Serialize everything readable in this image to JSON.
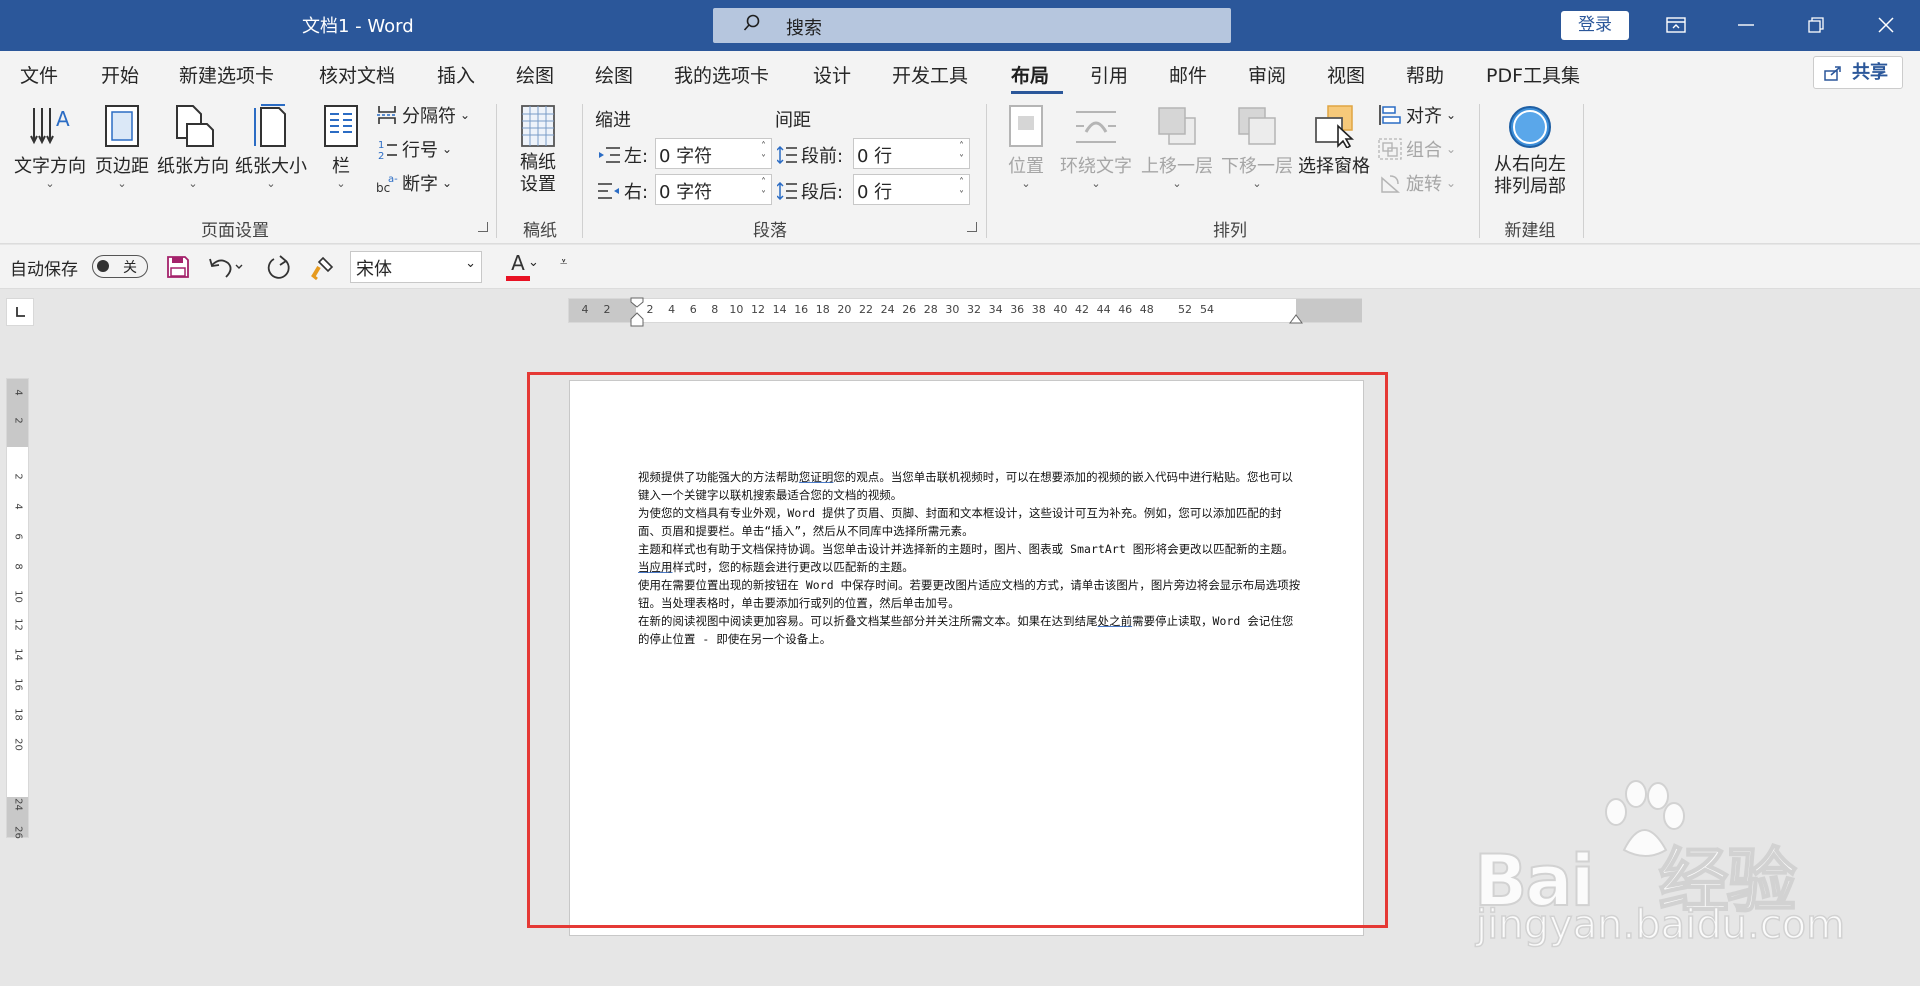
{
  "titlebar": {
    "title": "文档1  -  Word",
    "search_placeholder": "搜索",
    "login_label": "登录"
  },
  "menu": {
    "tabs": [
      {
        "label": "文件"
      },
      {
        "label": "开始"
      },
      {
        "label": "新建选项卡"
      },
      {
        "label": "核对文档"
      },
      {
        "label": "插入"
      },
      {
        "label": "绘图"
      },
      {
        "label": "绘图"
      },
      {
        "label": "我的选项卡"
      },
      {
        "label": "设计"
      },
      {
        "label": "开发工具"
      },
      {
        "label": "布局"
      },
      {
        "label": "引用"
      },
      {
        "label": "邮件"
      },
      {
        "label": "审阅"
      },
      {
        "label": "视图"
      },
      {
        "label": "帮助"
      },
      {
        "label": "PDF工具集"
      }
    ],
    "active_tab": "布局",
    "share_label": "共享"
  },
  "ribbon": {
    "page_setup": {
      "group_label": "页面设置",
      "text_direction": "文字方向",
      "margins": "页边距",
      "orientation": "纸张方向",
      "size": "纸张大小",
      "columns": "栏",
      "breaks": "分隔符",
      "line_numbers": "行号",
      "hyphenation": "断字"
    },
    "manuscript": {
      "group_label": "稿纸",
      "button": "稿纸\n设置",
      "button_line1": "稿纸",
      "button_line2": "设置"
    },
    "paragraph": {
      "group_label": "段落",
      "indent_title": "缩进",
      "spacing_title": "间距",
      "left_label": "左:",
      "right_label": "右:",
      "left_value": "0 字符",
      "right_value": "0 字符",
      "before_label": "段前:",
      "after_label": "段后:",
      "before_value": "0 行",
      "after_value": "0 行"
    },
    "arrange": {
      "group_label": "排列",
      "position": "位置",
      "wrap_text": "环绕文字",
      "bring_forward": "上移一层",
      "send_backward": "下移一层",
      "selection_pane": "选择窗格",
      "align": "对齐",
      "group": "组合",
      "rotate": "旋转"
    },
    "new_group": {
      "group_label": "新建组",
      "rtl_line1": "从右向左",
      "rtl_line2": "排列局部"
    }
  },
  "qat": {
    "autosave_label": "自动保存",
    "autosave_state": "关",
    "font_name": "宋体",
    "font_color_letter": "A"
  },
  "ruler": {
    "h_numbers": [
      "4",
      "2",
      "2",
      "4",
      "6",
      "8",
      "10",
      "12",
      "14",
      "16",
      "18",
      "20",
      "22",
      "24",
      "26",
      "28",
      "30",
      "32",
      "34",
      "36",
      "38",
      "40",
      "42",
      "44",
      "46",
      "48",
      "52",
      "54"
    ],
    "v_numbers": [
      "4",
      "2",
      "2",
      "4",
      "6",
      "8",
      "10",
      "12",
      "14",
      "16",
      "18",
      "20",
      "24",
      "26"
    ]
  },
  "document": {
    "paragraphs": [
      {
        "pre": "视频提供了功能强大的方法帮助",
        "u": "您证明",
        "post": "您的观点。当您单击联机视频时，可以在想要添加的视频的嵌入代码中进行粘贴。您也可以键入一个关键字以联机搜索最适合您的文档的视频。"
      },
      {
        "pre": "为使您的文档具有专业外观，Word 提供了页眉、页脚、封面和文本框设计，这些设计可互为补充。例如，您可以添加匹配的封面、页眉和提要栏。单击“插入”，然后从不同库中选择所需元素。",
        "u": "",
        "post": ""
      },
      {
        "pre": "主题和样式也有助于文档保持协调。当您单击设计并选择新的主题时，图片、图表或 SmartArt 图形将会更改以匹配新的主题。",
        "u": "当应用",
        "post": "样式时，您的标题会进行更改以匹配新的主题。"
      },
      {
        "pre": "使用在需要位置出现的新按钮在 Word 中保存时间。若要更改图片适应文档的方式，请单击该图片，图片旁边将会显示布局选项按钮。当处理表格时，单击要添加行或列的位置，然后单击加号。",
        "u": "",
        "post": ""
      },
      {
        "pre": "在新的阅读视图中阅读更加容易。可以折叠文档某些部分并关注所需文本。如果在达到结尾",
        "u": "处之前",
        "post": "需要停止读取，Word 会记住您的停止位置 - 即使在另一个设备上。"
      }
    ]
  },
  "watermark": {
    "brand": "Bai",
    "brand_cn": "经验",
    "url": "jingyan.baidu.com"
  }
}
